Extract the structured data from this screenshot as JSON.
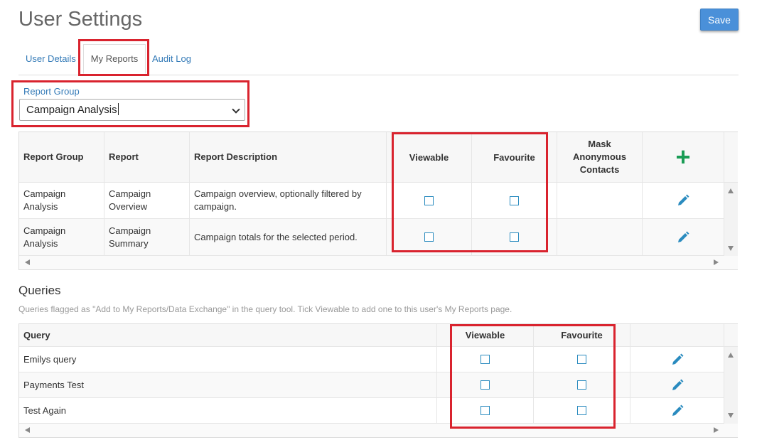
{
  "page": {
    "title": "User Settings",
    "save_label": "Save"
  },
  "tabs": [
    {
      "label": "User Details"
    },
    {
      "label": "My Reports"
    },
    {
      "label": "Audit Log"
    }
  ],
  "report_group": {
    "label": "Report Group",
    "selected": "Campaign Analysis"
  },
  "reports": {
    "headers": {
      "group": "Report Group",
      "report": "Report",
      "description": "Report Description",
      "viewable": "Viewable",
      "favourite": "Favourite",
      "mask": "Mask Anonymous Contacts",
      "add": "+"
    },
    "rows": [
      {
        "group": "Campaign Analysis",
        "report": "Campaign Overview",
        "description": "Campaign overview, optionally filtered by campaign.",
        "viewable": false,
        "favourite": false
      },
      {
        "group": "Campaign Analysis",
        "report": "Campaign Summary",
        "description": "Campaign totals for the selected period.",
        "viewable": false,
        "favourite": false
      }
    ]
  },
  "queries": {
    "title": "Queries",
    "description": "Queries flagged as \"Add to My Reports/Data Exchange\" in the query tool. Tick Viewable to add one to this user's My Reports page.",
    "headers": {
      "query": "Query",
      "viewable": "Viewable",
      "favourite": "Favourite"
    },
    "rows": [
      {
        "query": "Emilys query",
        "viewable": false,
        "favourite": false
      },
      {
        "query": "Payments Test",
        "viewable": false,
        "favourite": false
      },
      {
        "query": "Test Again",
        "viewable": false,
        "favourite": false
      }
    ]
  },
  "icons": {
    "edit": "pencil-icon",
    "add": "plus-icon"
  },
  "colors": {
    "accent": "#337ab7",
    "save_button": "#4a90d9",
    "add_icon": "#1a9c55",
    "highlight": "#d9232e"
  }
}
